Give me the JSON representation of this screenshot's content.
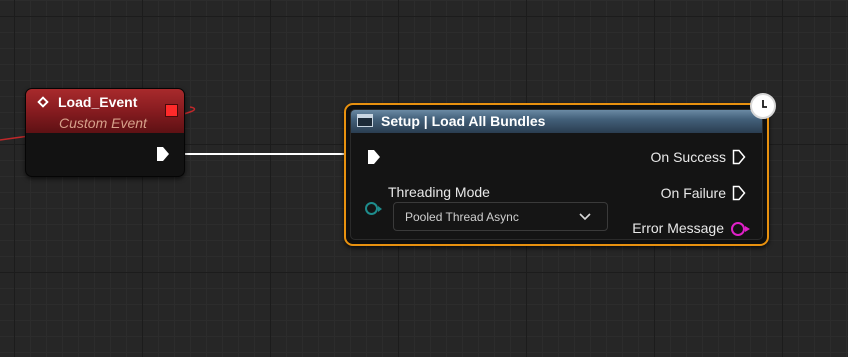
{
  "event_node": {
    "title": "Load_Event",
    "subtitle": "Custom Event",
    "icon": "event-diamond-icon",
    "color": "#a82a2c"
  },
  "function_node": {
    "title": "Setup | Load All Bundles",
    "icon": "function-icon",
    "latent_icon": "clock-icon",
    "border_color": "#e8910f",
    "inputs": {
      "threading_mode": {
        "label": "Threading Mode",
        "value": "Pooled Thread Async"
      }
    },
    "outputs": {
      "on_success": "On Success",
      "on_failure": "On Failure",
      "error_message": "Error Message"
    }
  },
  "colors": {
    "delegate_pin": "#ff2a2a",
    "enum_pin": "#1e8c8c",
    "string_pin": "#e020c8",
    "exec_wire": "#ffffff"
  }
}
